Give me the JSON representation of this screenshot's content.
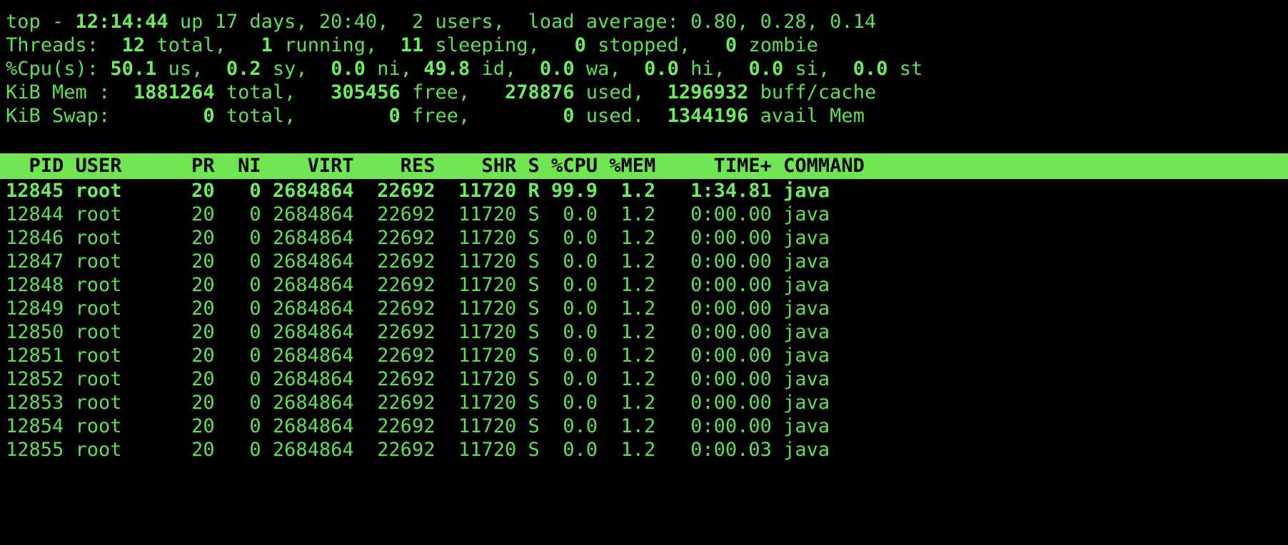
{
  "terminal": {
    "program": "top",
    "colors": {
      "background": "#000000",
      "foreground": "#5ce052",
      "header_background": "#6fe551",
      "header_foreground": "#000000",
      "bold_foreground": "#6ced5e"
    }
  },
  "summary": {
    "uptime_line": "top - 12:14:44 up 17 days, 20:40,  2 users,  load average: 0.80, 0.28, 0.14",
    "uptime": {
      "label": "top - ",
      "time": "12:14:44",
      "up_text": " up 17 days, 20:40,  2 users,  load average: 0.80, 0.28, 0.14"
    },
    "threads_line": "Threads:  12 total,   1 running,  11 sleeping,   0 stopped,   0 zombie",
    "threads": {
      "label": "Threads: ",
      "total": " 12",
      "total_label": " total, ",
      "running": "  1",
      "running_label": " running, ",
      "sleeping": " 11",
      "sleeping_label": " sleeping, ",
      "stopped": "  0",
      "stopped_label": " stopped, ",
      "zombie": "  0",
      "zombie_label": " zombie"
    },
    "cpu_line": "%Cpu(s): 50.1 us,  0.2 sy,  0.0 ni, 49.8 id,  0.0 wa,  0.0 hi,  0.0 si,  0.0 st",
    "cpu": {
      "label": "%Cpu(s): ",
      "us": "50.1",
      "us_label": " us, ",
      "sy": " 0.2",
      "sy_label": " sy, ",
      "ni": " 0.0",
      "ni_label": " ni, ",
      "id": "49.8",
      "id_label": " id, ",
      "wa": " 0.0",
      "wa_label": " wa, ",
      "hi": " 0.0",
      "hi_label": " hi, ",
      "si": " 0.0",
      "si_label": " si, ",
      "st": " 0.0",
      "st_label": " st"
    },
    "mem_line": "KiB Mem :  1881264 total,   305456 free,   278876 used,  1296932 buff/cache",
    "mem": {
      "label": "KiB Mem : ",
      "total": " 1881264",
      "total_label": " total, ",
      "free": "  305456",
      "free_label": " free, ",
      "used": "  278876",
      "used_label": " used, ",
      "buff_cache": " 1296932",
      "buff_cache_label": " buff/cache"
    },
    "swap_line": "KiB Swap:        0 total,        0 free,        0 used.  1344196 avail Mem",
    "swap": {
      "label": "KiB Swap: ",
      "total": "       0",
      "total_label": " total, ",
      "free": "       0",
      "free_label": " free, ",
      "used": "       0",
      "used_label": " used. ",
      "avail": " 1344196",
      "avail_label": " avail Mem"
    }
  },
  "process_table": {
    "header_text": "  PID USER      PR  NI    VIRT    RES    SHR S %CPU %MEM     TIME+ COMMAND",
    "columns": [
      "PID",
      "USER",
      "PR",
      "NI",
      "VIRT",
      "RES",
      "SHR",
      "S",
      "%CPU",
      "%MEM",
      "TIME+",
      "COMMAND"
    ],
    "rows": [
      {
        "text": "12845 root      20   0 2684864  22692  11720 R 99.9  1.2   1:34.81 java",
        "pid": "12845",
        "user": "root",
        "pr": "20",
        "ni": "0",
        "virt": "2684864",
        "res": "22692",
        "shr": "11720",
        "s": "R",
        "cpu": "99.9",
        "mem": "1.2",
        "time": "1:34.81",
        "command": "java",
        "bold": true
      },
      {
        "text": "12844 root      20   0 2684864  22692  11720 S  0.0  1.2   0:00.00 java",
        "pid": "12844",
        "user": "root",
        "pr": "20",
        "ni": "0",
        "virt": "2684864",
        "res": "22692",
        "shr": "11720",
        "s": "S",
        "cpu": "0.0",
        "mem": "1.2",
        "time": "0:00.00",
        "command": "java",
        "bold": false
      },
      {
        "text": "12846 root      20   0 2684864  22692  11720 S  0.0  1.2   0:00.00 java",
        "pid": "12846",
        "user": "root",
        "pr": "20",
        "ni": "0",
        "virt": "2684864",
        "res": "22692",
        "shr": "11720",
        "s": "S",
        "cpu": "0.0",
        "mem": "1.2",
        "time": "0:00.00",
        "command": "java",
        "bold": false
      },
      {
        "text": "12847 root      20   0 2684864  22692  11720 S  0.0  1.2   0:00.00 java",
        "pid": "12847",
        "user": "root",
        "pr": "20",
        "ni": "0",
        "virt": "2684864",
        "res": "22692",
        "shr": "11720",
        "s": "S",
        "cpu": "0.0",
        "mem": "1.2",
        "time": "0:00.00",
        "command": "java",
        "bold": false
      },
      {
        "text": "12848 root      20   0 2684864  22692  11720 S  0.0  1.2   0:00.00 java",
        "pid": "12848",
        "user": "root",
        "pr": "20",
        "ni": "0",
        "virt": "2684864",
        "res": "22692",
        "shr": "11720",
        "s": "S",
        "cpu": "0.0",
        "mem": "1.2",
        "time": "0:00.00",
        "command": "java",
        "bold": false
      },
      {
        "text": "12849 root      20   0 2684864  22692  11720 S  0.0  1.2   0:00.00 java",
        "pid": "12849",
        "user": "root",
        "pr": "20",
        "ni": "0",
        "virt": "2684864",
        "res": "22692",
        "shr": "11720",
        "s": "S",
        "cpu": "0.0",
        "mem": "1.2",
        "time": "0:00.00",
        "command": "java",
        "bold": false
      },
      {
        "text": "12850 root      20   0 2684864  22692  11720 S  0.0  1.2   0:00.00 java",
        "pid": "12850",
        "user": "root",
        "pr": "20",
        "ni": "0",
        "virt": "2684864",
        "res": "22692",
        "shr": "11720",
        "s": "S",
        "cpu": "0.0",
        "mem": "1.2",
        "time": "0:00.00",
        "command": "java",
        "bold": false
      },
      {
        "text": "12851 root      20   0 2684864  22692  11720 S  0.0  1.2   0:00.00 java",
        "pid": "12851",
        "user": "root",
        "pr": "20",
        "ni": "0",
        "virt": "2684864",
        "res": "22692",
        "shr": "11720",
        "s": "S",
        "cpu": "0.0",
        "mem": "1.2",
        "time": "0:00.00",
        "command": "java",
        "bold": false
      },
      {
        "text": "12852 root      20   0 2684864  22692  11720 S  0.0  1.2   0:00.00 java",
        "pid": "12852",
        "user": "root",
        "pr": "20",
        "ni": "0",
        "virt": "2684864",
        "res": "22692",
        "shr": "11720",
        "s": "S",
        "cpu": "0.0",
        "mem": "1.2",
        "time": "0:00.00",
        "command": "java",
        "bold": false
      },
      {
        "text": "12853 root      20   0 2684864  22692  11720 S  0.0  1.2   0:00.00 java",
        "pid": "12853",
        "user": "root",
        "pr": "20",
        "ni": "0",
        "virt": "2684864",
        "res": "22692",
        "shr": "11720",
        "s": "S",
        "cpu": "0.0",
        "mem": "1.2",
        "time": "0:00.00",
        "command": "java",
        "bold": false
      },
      {
        "text": "12854 root      20   0 2684864  22692  11720 S  0.0  1.2   0:00.00 java",
        "pid": "12854",
        "user": "root",
        "pr": "20",
        "ni": "0",
        "virt": "2684864",
        "res": "22692",
        "shr": "11720",
        "s": "S",
        "cpu": "0.0",
        "mem": "1.2",
        "time": "0:00.00",
        "command": "java",
        "bold": false
      },
      {
        "text": "12855 root      20   0 2684864  22692  11720 S  0.0  1.2   0:00.03 java",
        "pid": "12855",
        "user": "root",
        "pr": "20",
        "ni": "0",
        "virt": "2684864",
        "res": "22692",
        "shr": "11720",
        "s": "S",
        "cpu": "0.0",
        "mem": "1.2",
        "time": "0:00.03",
        "command": "java",
        "bold": false
      }
    ]
  }
}
